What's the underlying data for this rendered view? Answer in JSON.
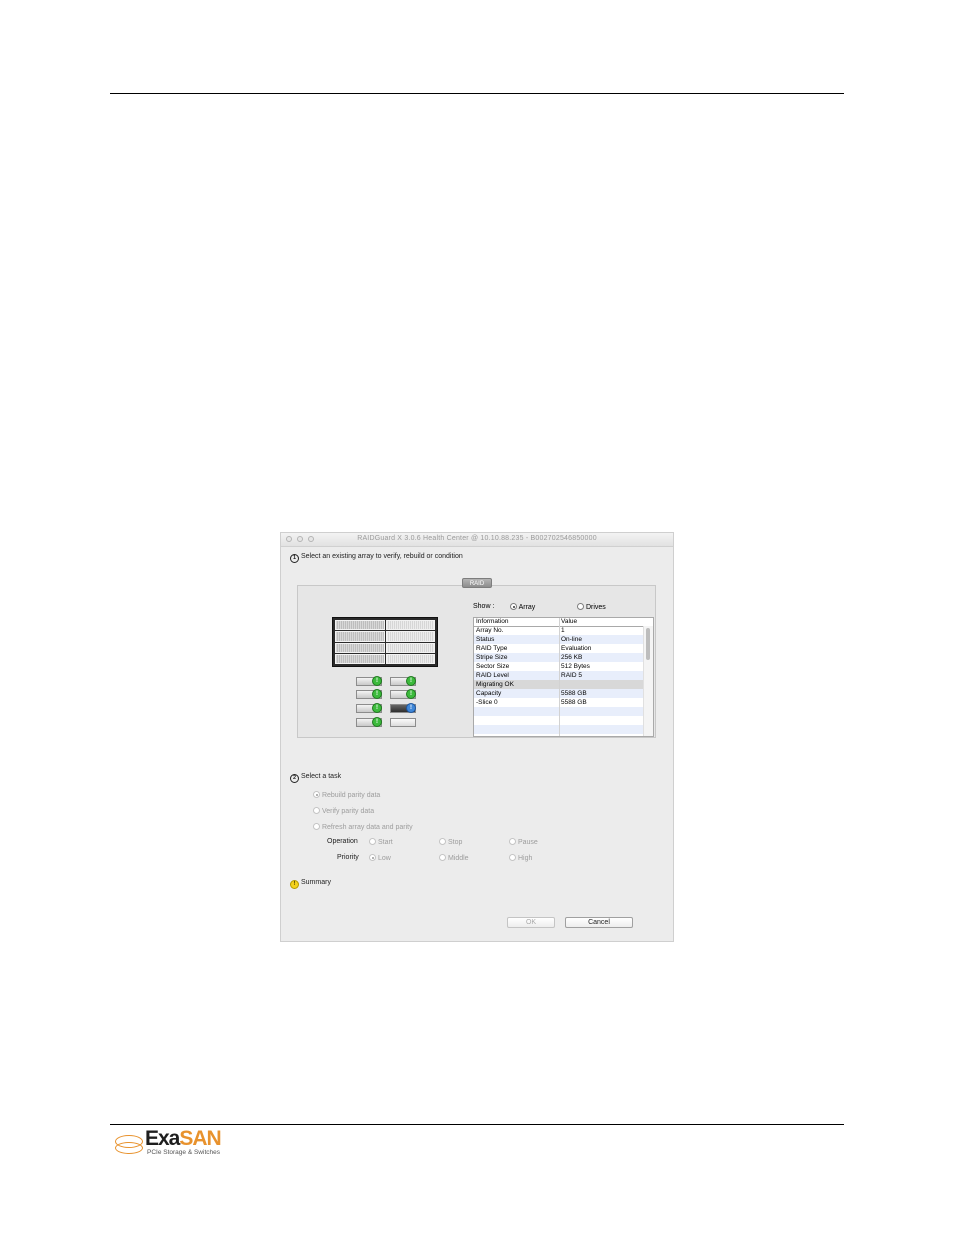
{
  "window": {
    "title": "RAIDGuard X 3.0.6 Health Center @ 10.10.88.235 - B002702546850000"
  },
  "step1": {
    "number": "1",
    "label": "Select an existing array to verify, rebuild or condition"
  },
  "raid_tab": "RAID",
  "show": {
    "label": "Show :",
    "options": [
      {
        "label": "Array",
        "selected": true
      },
      {
        "label": "Drives",
        "selected": false
      }
    ]
  },
  "enclosure": {
    "drive_status_colors": {
      "ok": "#3cba3c",
      "selected": "#3f86d6"
    },
    "drives": [
      {
        "led": "ok"
      },
      {
        "led": "ok"
      },
      {
        "led": "ok"
      },
      {
        "led": "ok"
      },
      {
        "led": "ok"
      },
      {
        "led": "selected"
      },
      {
        "led": "ok"
      },
      {
        "led": "none"
      }
    ]
  },
  "info_table": {
    "headers": [
      "Information",
      "Value"
    ],
    "rows": [
      {
        "info": "Array No.",
        "value": "1"
      },
      {
        "info": "Status",
        "value": "On-line"
      },
      {
        "info": "RAID Type",
        "value": "Evaluation"
      },
      {
        "info": "Stripe Size",
        "value": "256 KB"
      },
      {
        "info": "Sector Size",
        "value": "512 Bytes"
      },
      {
        "info": "RAID Level",
        "value": "RAID 5"
      },
      {
        "info": "Migrating OK",
        "value": ""
      },
      {
        "info": "Capacity",
        "value": "5588 GB"
      },
      {
        "info": "-Slice 0",
        "value": " 5588 GB"
      }
    ]
  },
  "step2": {
    "number": "2",
    "label": "Select a task"
  },
  "tasks": [
    {
      "label": "Rebuild parity data",
      "selected": true
    },
    {
      "label": "Verify parity data",
      "selected": false
    },
    {
      "label": "Refresh array data and parity",
      "selected": false
    }
  ],
  "operation": {
    "label": "Operation",
    "options": [
      "Start",
      "Stop",
      "Pause"
    ]
  },
  "priority": {
    "label": "Priority",
    "options": [
      "Low",
      "Middle",
      "High"
    ],
    "selected": "Low"
  },
  "summary": {
    "icon": "!",
    "label": "Summary"
  },
  "buttons": {
    "ok": "OK",
    "cancel": "Cancel"
  },
  "logo": {
    "word_a": "Exa",
    "word_b": "SAN",
    "tagline": "PCIe Storage & Switches",
    "brand_color": "#e8922d"
  }
}
